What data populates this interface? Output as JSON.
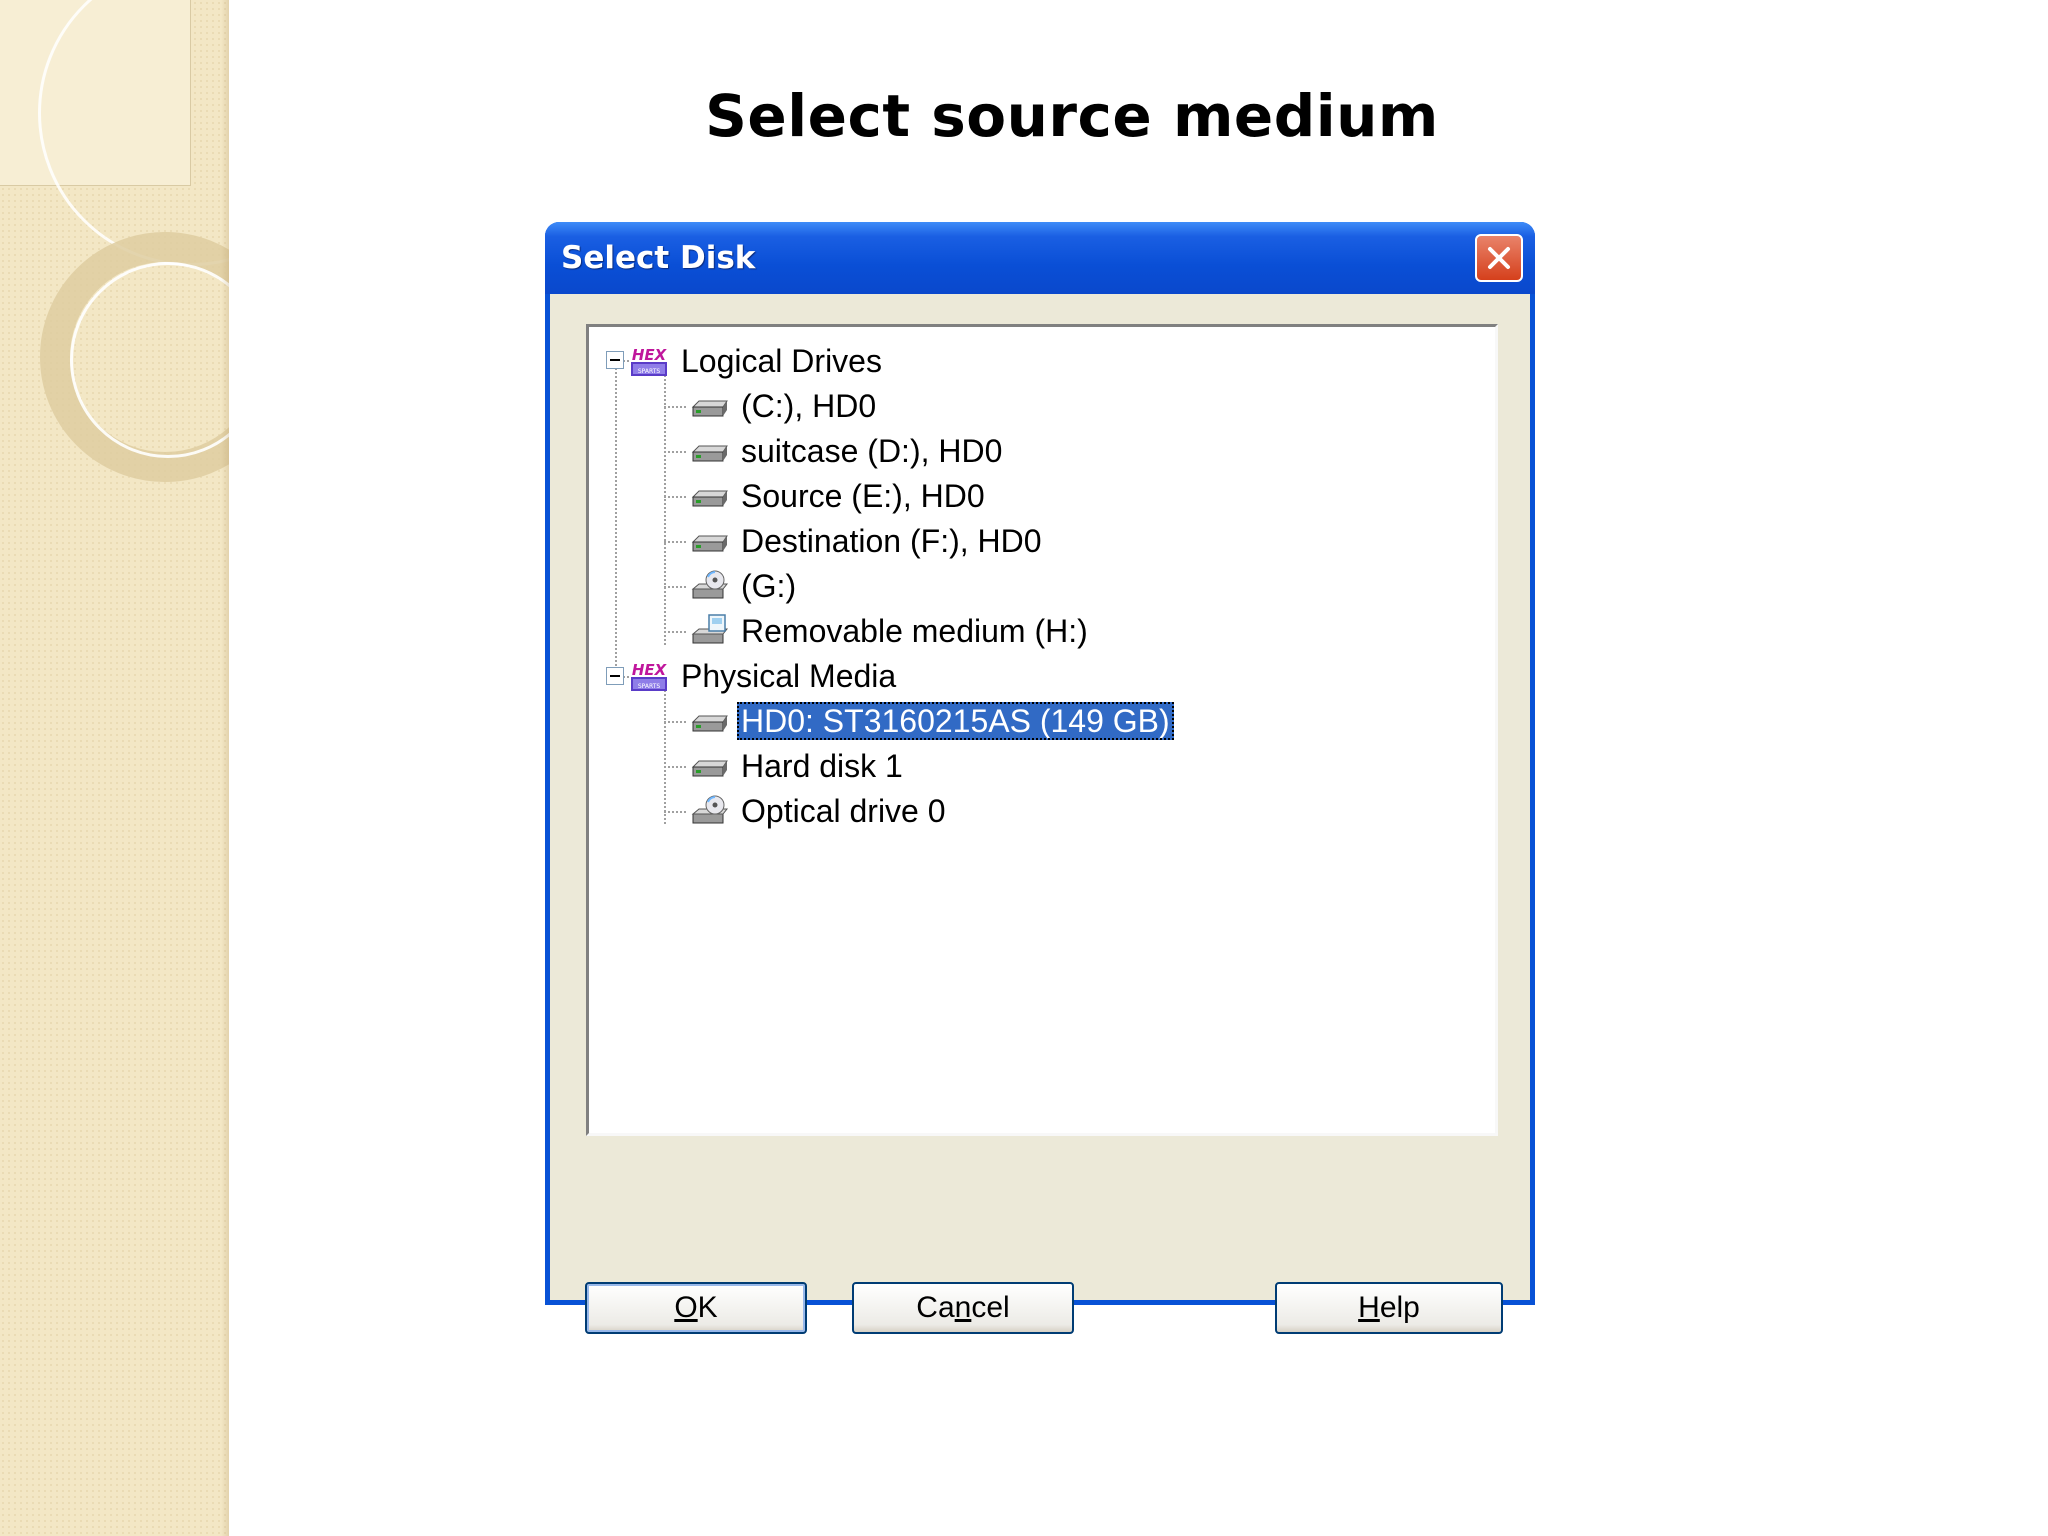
{
  "slide": {
    "title": "Select source medium"
  },
  "dialog": {
    "title": "Select Disk",
    "tree": {
      "groups": [
        {
          "label": "Logical Drives",
          "icon": "hex-icon",
          "items": [
            {
              "label": "(C:), HD0",
              "icon": "hard-drive-icon"
            },
            {
              "label": "suitcase (D:), HD0",
              "icon": "hard-drive-icon"
            },
            {
              "label": "Source (E:), HD0",
              "icon": "hard-drive-icon"
            },
            {
              "label": "Destination (F:), HD0",
              "icon": "hard-drive-icon"
            },
            {
              "label": "(G:)",
              "icon": "optical-drive-icon"
            },
            {
              "label": "Removable medium (H:)",
              "icon": "removable-drive-icon"
            }
          ]
        },
        {
          "label": "Physical Media",
          "icon": "hex-icon",
          "items": [
            {
              "label": "HD0: ST3160215AS (149 GB)",
              "icon": "hard-drive-icon",
              "selected": true
            },
            {
              "label": "Hard disk 1",
              "icon": "hard-drive-icon"
            },
            {
              "label": "Optical drive 0",
              "icon": "optical-drive-icon"
            }
          ]
        }
      ]
    },
    "buttons": {
      "ok": {
        "mnemonic": "O",
        "rest": "K"
      },
      "cancel": {
        "pre": "Ca",
        "mnemonic": "n",
        "rest": "cel"
      },
      "help": {
        "mnemonic": "H",
        "rest": "elp"
      }
    },
    "colors": {
      "titlebar": "#0a4fd6",
      "selection": "#316ac5",
      "face": "#ece9d8"
    }
  }
}
